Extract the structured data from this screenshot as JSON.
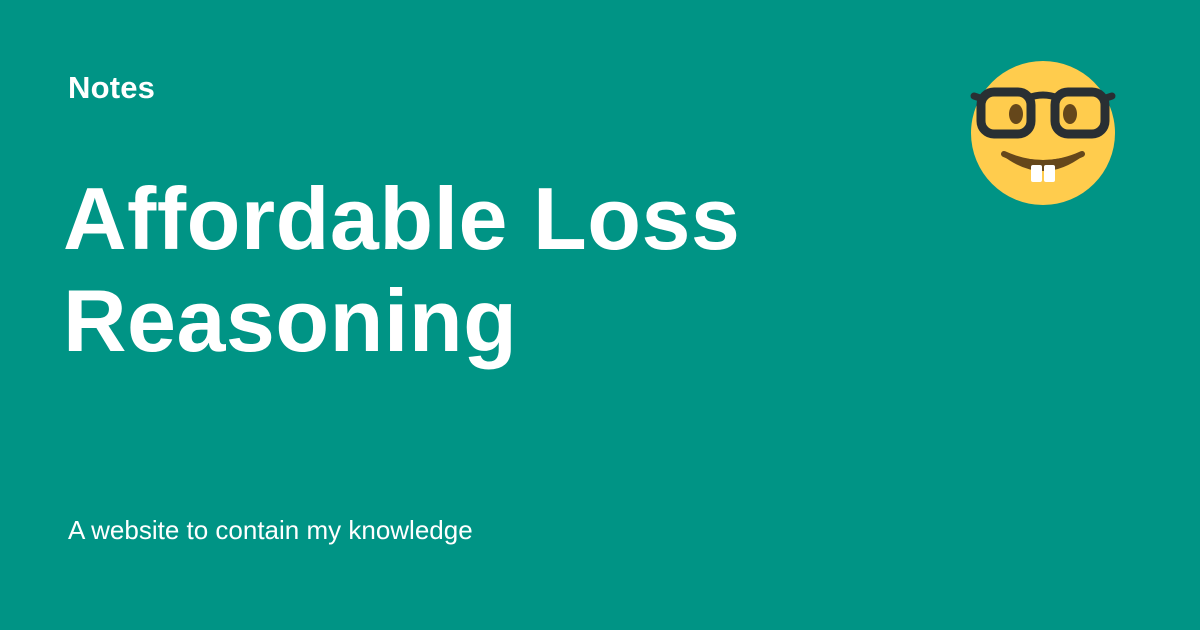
{
  "card": {
    "site_name": "Notes",
    "title_lines": [
      "Affordable Loss",
      "Reasoning"
    ],
    "description": "A website to contain my knowledge",
    "emoji_icon": "nerd-face-icon"
  },
  "colors": {
    "background": "#009485",
    "text": "#ffffff",
    "emoji_face": "#FFCC4D",
    "emoji_features": "#292F33",
    "emoji_eyes": "#65471B"
  }
}
